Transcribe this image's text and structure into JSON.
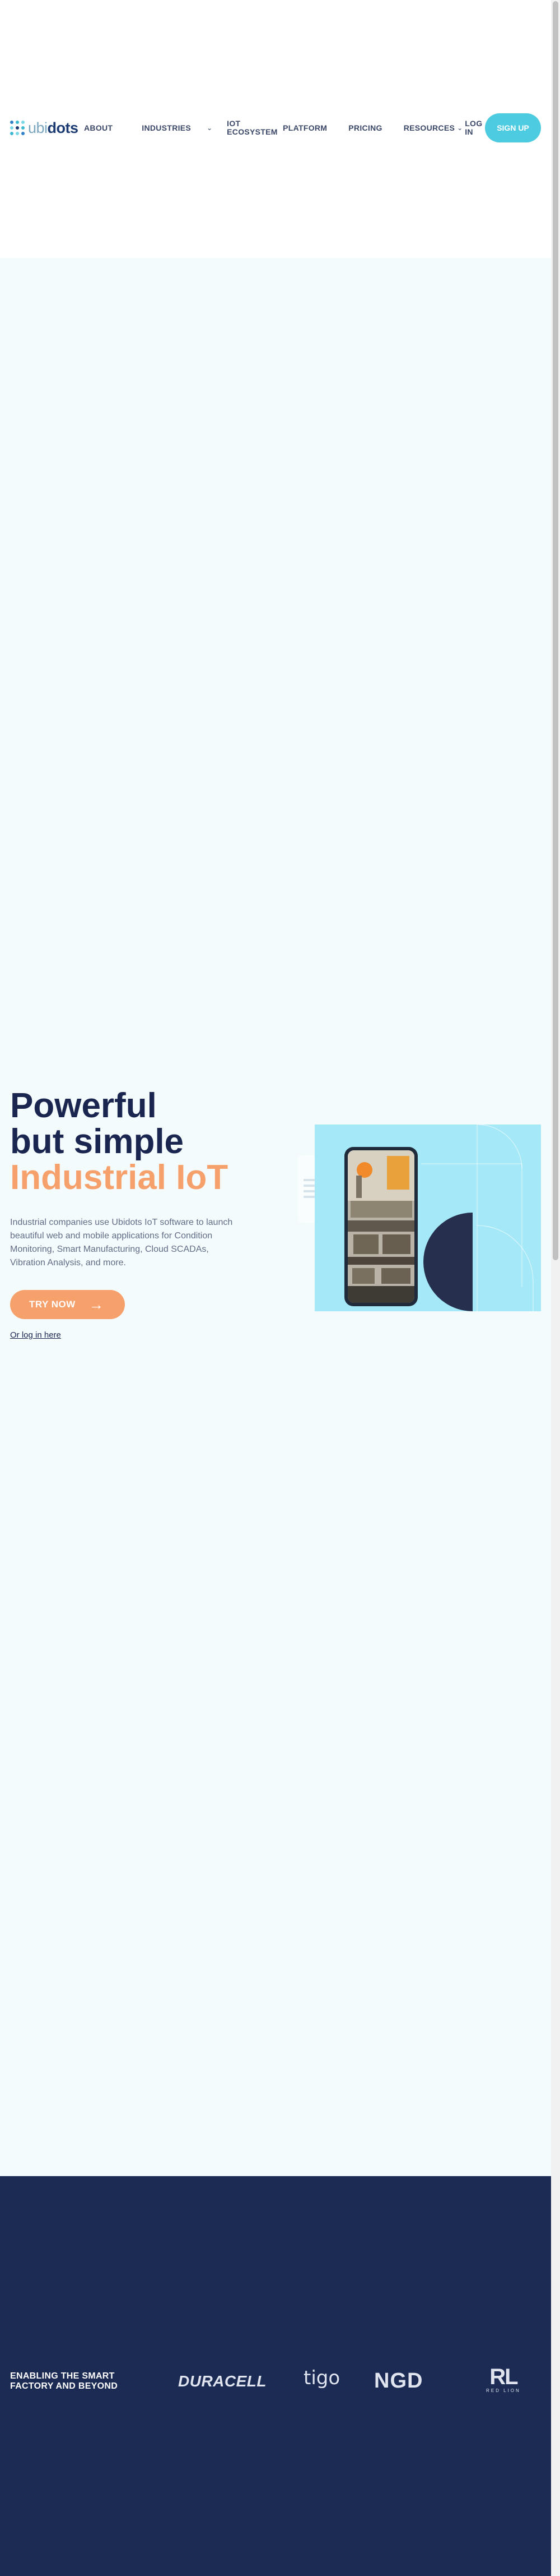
{
  "nav": {
    "logo_light": "ubi",
    "logo_bold": "dots",
    "items": [
      {
        "label": "ABOUT"
      },
      {
        "label": "INDUSTRIES"
      },
      {
        "label": "IOT ECOSYSTEM"
      },
      {
        "label": "PLATFORM"
      },
      {
        "label": "PRICING"
      },
      {
        "label": "RESOURCES"
      }
    ],
    "login": "LOG IN",
    "signup": "SIGN UP"
  },
  "hero": {
    "title_line1": "Powerful",
    "title_line2": "but simple",
    "title_accent": "Industrial IoT",
    "description": "Industrial companies use Ubidots IoT software to launch beautiful web and mobile applications for Condition Monitoring, Smart Manufacturing, Cloud SCADAs, Vibration Analysis, and more.",
    "cta": "TRY NOW",
    "login_link": "Or log in here"
  },
  "clients": {
    "label": "ENABLING THE SMART FACTORY AND BEYOND",
    "logos": [
      "DURACELL",
      "tigo",
      "NGD",
      "RL"
    ],
    "rl_sub": "RED LION"
  },
  "colors": {
    "accent": "#f6a16b",
    "brand_cyan": "#4dcbe0",
    "navy": "#1c2b54",
    "hero_bg": "#f4fbfd"
  },
  "icons": [
    "ubidots-logo-icon",
    "chevron-down-icon",
    "arrow-right-icon"
  ]
}
